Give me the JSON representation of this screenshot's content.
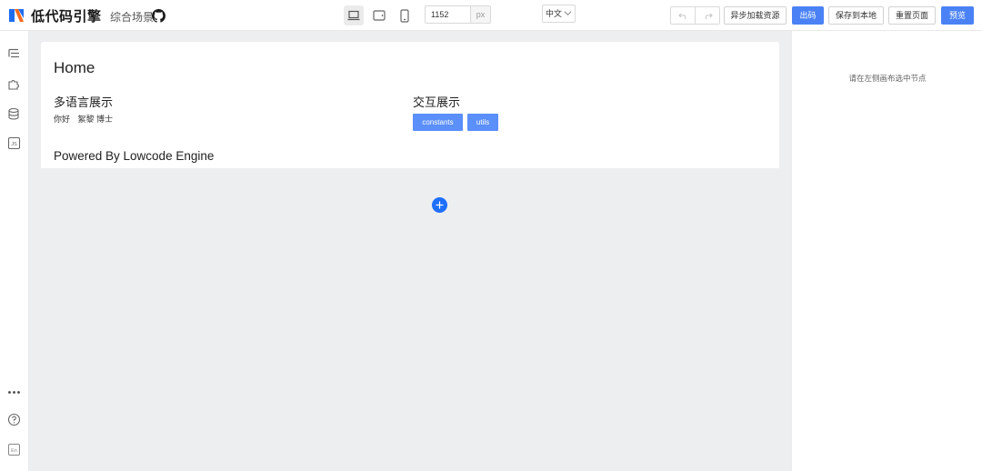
{
  "header": {
    "brand": "低代码引擎",
    "scene": "综合场景",
    "canvas_width": "1152",
    "canvas_unit": "px",
    "language": "中文",
    "buttons": {
      "async_load": "异步加载资源",
      "output_code": "出码",
      "save_local": "保存到本地",
      "reset_page": "重置页面",
      "preview": "预览"
    },
    "accent_color": "#4a82f6"
  },
  "sidebar": {
    "icons": [
      "outline-tree-icon",
      "component-puzzle-icon",
      "datasource-icon",
      "js-code-icon",
      "more-icon",
      "help-icon",
      "language-switch-icon"
    ],
    "lang_badge": "En"
  },
  "canvas": {
    "page_title": "Home",
    "sections": {
      "i18n_title": "多语言展示",
      "i18n_texts": [
        "你好",
        "絮黎 博士"
      ],
      "interact_title": "交互展示",
      "interact_buttons": [
        "constants",
        "utils"
      ]
    },
    "footer": "Powered By Lowcode Engine"
  },
  "right_panel": {
    "hint": "请在左侧画布选中节点"
  }
}
